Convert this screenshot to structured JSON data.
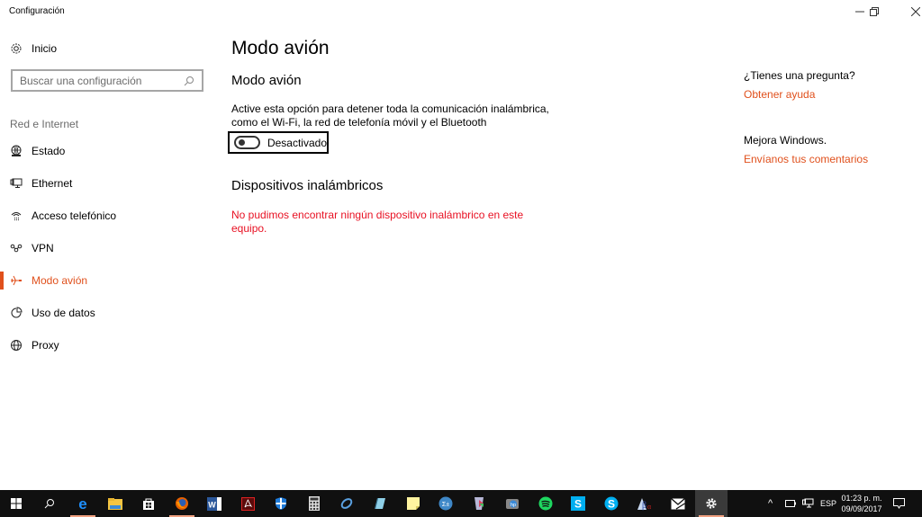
{
  "window": {
    "title": "Configuración",
    "controls": {
      "minimize": "—",
      "restore": "❐",
      "close": "✕"
    }
  },
  "sidebar": {
    "home_label": "Inicio",
    "home_icon": "gear-icon",
    "search_placeholder": "Buscar una configuración",
    "search_icon": "search-icon",
    "section_label": "Red e Internet",
    "items": [
      {
        "label": "Estado",
        "icon": "globe-status-icon",
        "active": false
      },
      {
        "label": "Ethernet",
        "icon": "ethernet-monitor-icon",
        "active": false
      },
      {
        "label": "Acceso telefónico",
        "icon": "dial-up-phone-icon",
        "active": false
      },
      {
        "label": "VPN",
        "icon": "vpn-icon",
        "active": false
      },
      {
        "label": "Modo avión",
        "icon": "airplane-icon",
        "active": true
      },
      {
        "label": "Uso de datos",
        "icon": "pie-chart-icon",
        "active": false
      },
      {
        "label": "Proxy",
        "icon": "globe-icon",
        "active": false
      }
    ]
  },
  "main": {
    "page_title": "Modo avión",
    "airplane_section_title": "Modo avión",
    "airplane_description": "Active esta opción para detener toda la comunicación inalámbrica, como el Wi-Fi, la red de telefonía móvil y el Bluetooth",
    "toggle_state": "Desactivado",
    "toggle_on": false,
    "wireless_section_title": "Dispositivos inalámbricos",
    "wireless_error": "No pudimos encontrar ningún dispositivo inalámbrico en este equipo."
  },
  "right_panel": {
    "question": "¿Tienes una pregunta?",
    "help_link": "Obtener ayuda",
    "improve": "Mejora Windows.",
    "feedback_link": "Envíanos tus comentarios"
  },
  "colors": {
    "accent": "#e0501c",
    "error": "#e81123",
    "taskbar": "#101010"
  },
  "taskbar": {
    "apps": [
      {
        "name": "start",
        "icon": "windows-logo-icon",
        "running": false
      },
      {
        "name": "search",
        "icon": "search-icon",
        "running": false
      },
      {
        "name": "edge",
        "icon": "edge-icon",
        "running": true
      },
      {
        "name": "file-explorer",
        "icon": "folder-icon",
        "running": false
      },
      {
        "name": "store",
        "icon": "store-bag-icon",
        "running": false
      },
      {
        "name": "firefox",
        "icon": "firefox-icon",
        "running": true
      },
      {
        "name": "word",
        "icon": "word-icon",
        "running": false
      },
      {
        "name": "acrobat",
        "icon": "pdf-icon",
        "running": false
      },
      {
        "name": "defender",
        "icon": "shield-icon",
        "running": false
      },
      {
        "name": "calculator",
        "icon": "calculator-icon",
        "running": false
      },
      {
        "name": "app-ring",
        "icon": "ring-icon",
        "running": false
      },
      {
        "name": "notepad",
        "icon": "notepad-icon",
        "running": false
      },
      {
        "name": "sticky-notes",
        "icon": "sticky-note-icon",
        "running": false
      },
      {
        "name": "math",
        "icon": "math-icon",
        "running": false
      },
      {
        "name": "prism-app",
        "icon": "prism-icon",
        "running": false
      },
      {
        "name": "hp-app",
        "icon": "hp-icon",
        "running": false
      },
      {
        "name": "spotify",
        "icon": "spotify-icon",
        "running": false
      },
      {
        "name": "skype",
        "icon": "skype-icon",
        "running": false
      },
      {
        "name": "skype-2",
        "icon": "skype-icon",
        "running": false
      },
      {
        "name": "char-app",
        "icon": "beta-alpha-icon",
        "running": false
      },
      {
        "name": "mail",
        "icon": "mail-icon",
        "running": false
      },
      {
        "name": "settings",
        "icon": "gear-icon",
        "running": true,
        "active": true
      }
    ],
    "tray": {
      "chevron": "^",
      "language": "ESP",
      "time": "01:23 p. m.",
      "date": "09/09/2017"
    }
  }
}
